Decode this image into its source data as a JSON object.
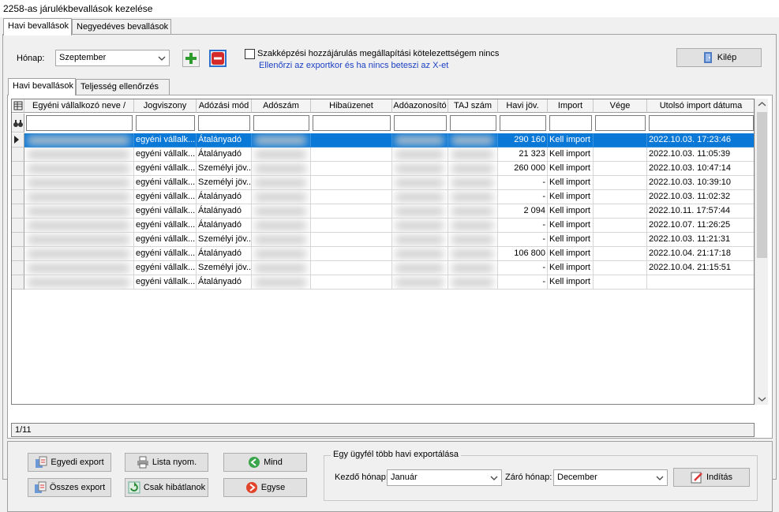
{
  "window": {
    "title": "2258-as járulékbevallások kezelése"
  },
  "outer_tabs": [
    {
      "label": "Havi bevallások",
      "active": true
    },
    {
      "label": "Negyedéves bevallások",
      "active": false
    }
  ],
  "toolbar": {
    "month_label": "Hónap:",
    "month_value": "Szeptember",
    "add_icon": "plus-icon",
    "remove_icon": "minus-icon",
    "checkbox_label": "Szakképzési hozzájárulás megállapítási kötelezettségem nincs",
    "checkbox_hint": "Ellenőrzi az exportkor és ha nincs beteszi az X-et",
    "exit_label": "Kilép"
  },
  "inner_tabs": [
    {
      "label": "Havi bevallások",
      "active": true
    },
    {
      "label": "Teljesség ellenőrzés",
      "active": false
    }
  ],
  "grid": {
    "columns": [
      "Egyéni vállalkozó neve",
      "Jogviszony",
      "Adózási mód",
      "Adószám",
      "Hibaüzenet",
      "Adóazonosító",
      "TAJ szám",
      "Havi jöv.",
      "Import",
      "Vége",
      "Utolsó import dátuma"
    ],
    "sort_indicator": "/",
    "rows": [
      {
        "jogviszony": "egyéni vállalk...",
        "adozasi_mod": "Átalányadó",
        "havi_jov": "290 160",
        "import": "Kell import",
        "datum": "2022.10.03. 17:23:46",
        "selected": true
      },
      {
        "jogviszony": "egyéni vállalk...",
        "adozasi_mod": "Átalányadó",
        "havi_jov": "21 323",
        "import": "Kell import",
        "datum": "2022.10.03. 11:05:39"
      },
      {
        "jogviszony": "egyéni vállalk...",
        "adozasi_mod": "Személyi jöv...",
        "havi_jov": "260 000",
        "import": "Kell import",
        "datum": "2022.10.03. 10:47:14"
      },
      {
        "jogviszony": "egyéni vállalk...",
        "adozasi_mod": "Személyi jöv...",
        "havi_jov": "-",
        "import": "Kell import",
        "datum": "2022.10.03. 10:39:10"
      },
      {
        "jogviszony": "egyéni vállalk...",
        "adozasi_mod": "Átalányadó",
        "havi_jov": "-",
        "import": "Kell import",
        "datum": "2022.10.03. 11:02:32"
      },
      {
        "jogviszony": "egyéni vállalk...",
        "adozasi_mod": "Átalányadó",
        "havi_jov": "2 094",
        "import": "Kell import",
        "datum": "2022.10.11. 17:57:44"
      },
      {
        "jogviszony": "egyéni vállalk...",
        "adozasi_mod": "Átalányadó",
        "havi_jov": "-",
        "import": "Kell import",
        "datum": "2022.10.07. 11:26:25"
      },
      {
        "jogviszony": "egyéni vállalk...",
        "adozasi_mod": "Személyi jöv...",
        "havi_jov": "-",
        "import": "Kell import",
        "datum": "2022.10.03. 11:21:31"
      },
      {
        "jogviszony": "egyéni vállalk...",
        "adozasi_mod": "Átalányadó",
        "havi_jov": "106 800",
        "import": "Kell import",
        "datum": "2022.10.04. 21:17:18"
      },
      {
        "jogviszony": "egyéni vállalk...",
        "adozasi_mod": "Személyi jöv...",
        "havi_jov": "-",
        "import": "Kell import",
        "datum": "2022.10.04. 21:15:51"
      },
      {
        "jogviszony": "egyéni vállalk...",
        "adozasi_mod": "Átalányadó",
        "havi_jov": "-",
        "import": "Kell import",
        "datum": ""
      }
    ],
    "record_counter": "1/11"
  },
  "buttons": {
    "egyedi_export": "Egyedi export",
    "osszes_export": "Összes export",
    "lista_nyom": "Lista nyom.",
    "csak_hibatlanok": "Csak hibátlanok",
    "mind": "Mind",
    "egyse": "Egyse"
  },
  "multi_export": {
    "legend": "Egy ügyfél több havi exportálása",
    "start_label": "Kezdő hónap:",
    "start_value": "Január",
    "end_label": "Záró hónap:",
    "end_value": "December",
    "start_button": "Indítás"
  },
  "colors": {
    "selection": "#0a78d7",
    "add_green": "#2e9b2e",
    "remove_red": "#d42a2a"
  }
}
